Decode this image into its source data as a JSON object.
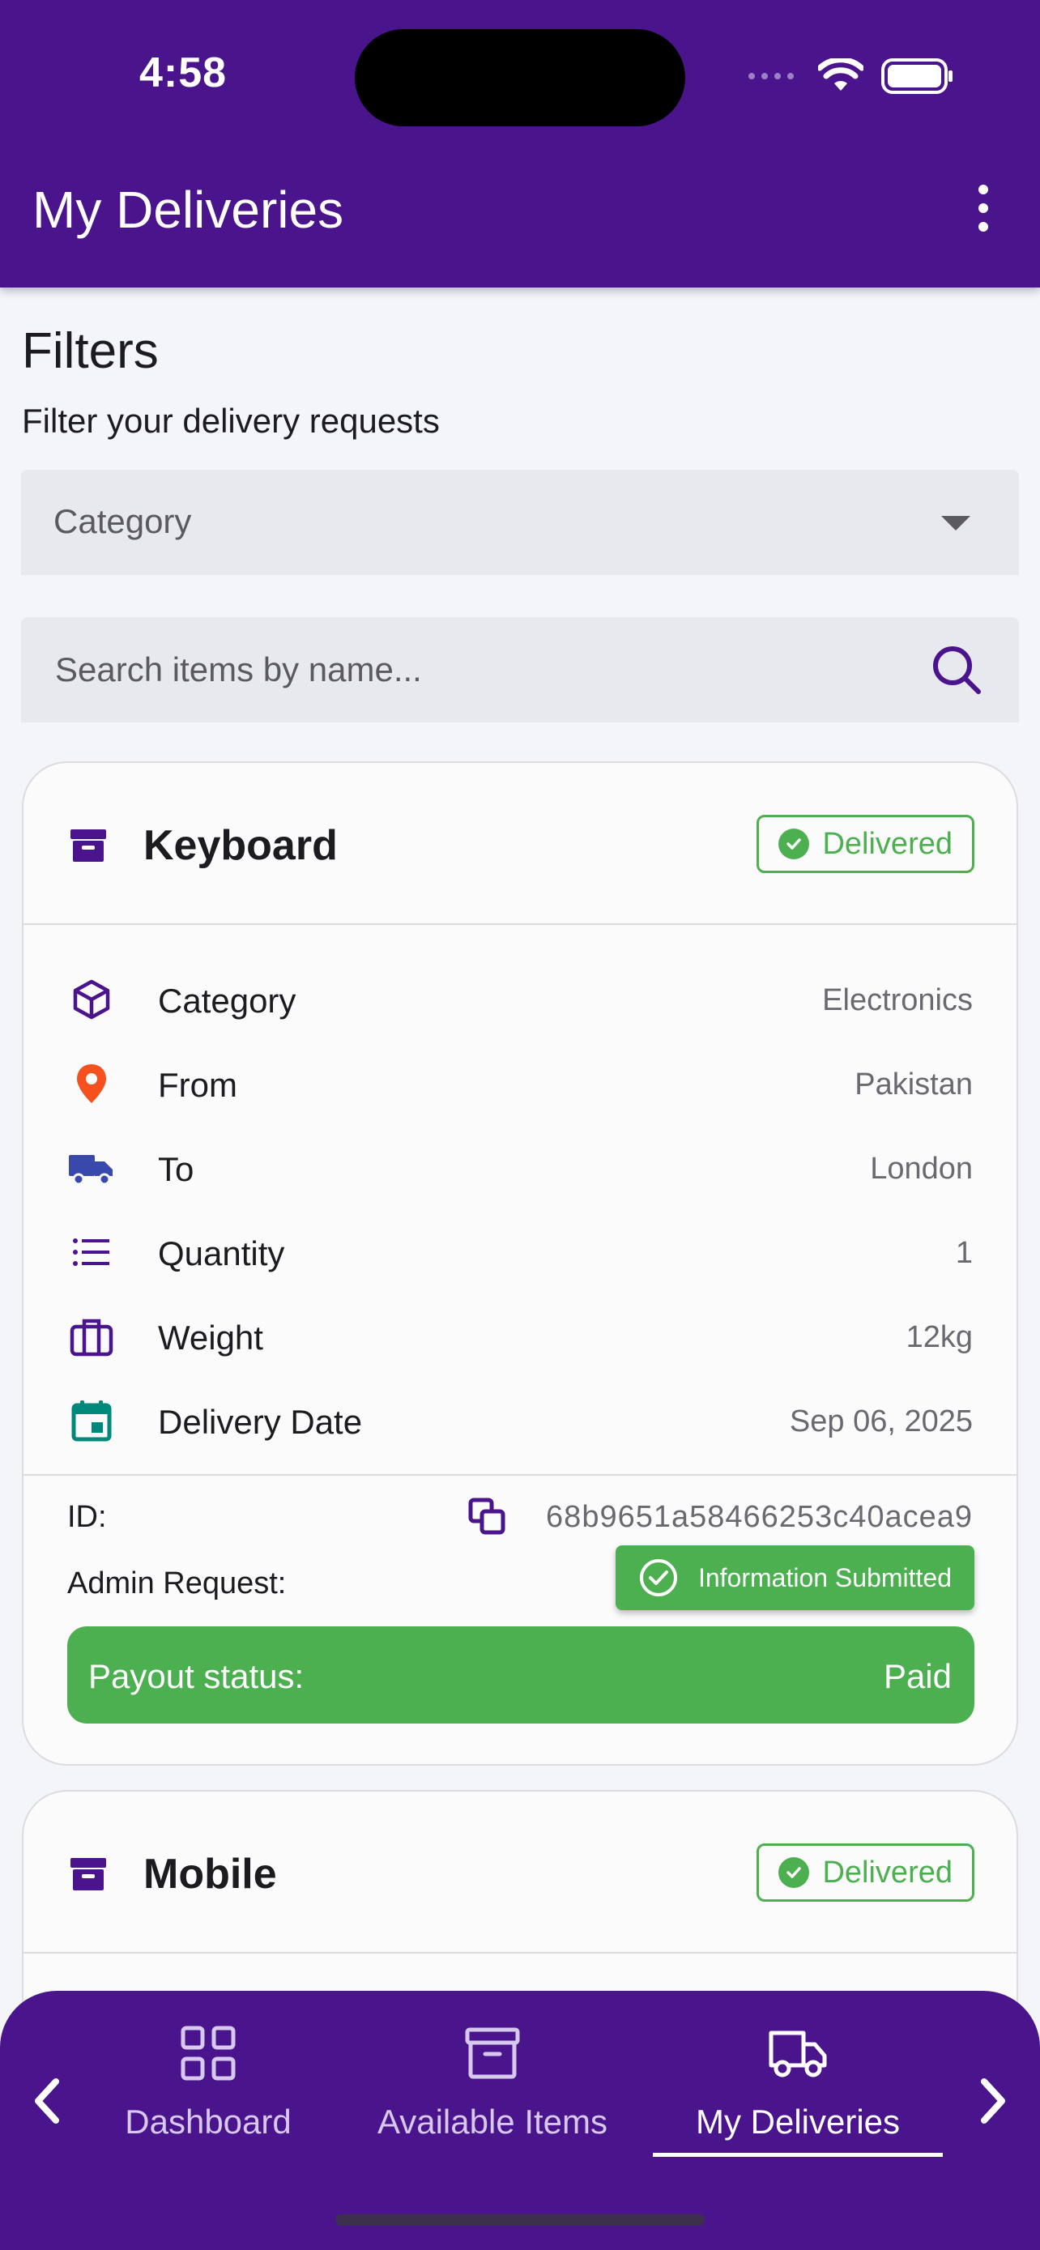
{
  "status_bar": {
    "time": "4:58"
  },
  "header": {
    "title": "My Deliveries",
    "menu_icon": "more-vertical-icon"
  },
  "filters": {
    "title": "Filters",
    "subtitle": "Filter your delivery requests",
    "category_label": "Category",
    "search_placeholder": "Search items by name..."
  },
  "cards": [
    {
      "name": "Keyboard",
      "status": "Delivered",
      "details": [
        {
          "label": "Category",
          "value": "Electronics",
          "icon": "cube-icon"
        },
        {
          "label": "From",
          "value": "Pakistan",
          "icon": "location-pin-icon"
        },
        {
          "label": "To",
          "value": "London",
          "icon": "truck-icon"
        },
        {
          "label": "Quantity",
          "value": "1",
          "icon": "list-icon"
        },
        {
          "label": "Weight",
          "value": "12kg",
          "icon": "briefcase-icon"
        },
        {
          "label": "Delivery Date",
          "value": "Sep 06, 2025",
          "icon": "calendar-icon"
        }
      ],
      "id_label": "ID:",
      "id_value": "68b9651a58466253c40acea9",
      "admin_request_label": "Admin Request:",
      "admin_request_status": "Information Submitted",
      "payout_label": "Payout status:",
      "payout_value": "Paid"
    },
    {
      "name": "Mobile",
      "status": "Delivered"
    }
  ],
  "bottom_nav": {
    "items": [
      {
        "label": "Dashboard",
        "icon": "grid-icon"
      },
      {
        "label": "Available Items",
        "icon": "archive-icon"
      },
      {
        "label": "My Deliveries",
        "icon": "truck-icon"
      }
    ],
    "active_index": 2
  },
  "colors": {
    "primary": "#4a148c",
    "success": "#4caf50",
    "pin": "#f4511e",
    "truck": "#3949ab",
    "calendar": "#00897b"
  }
}
